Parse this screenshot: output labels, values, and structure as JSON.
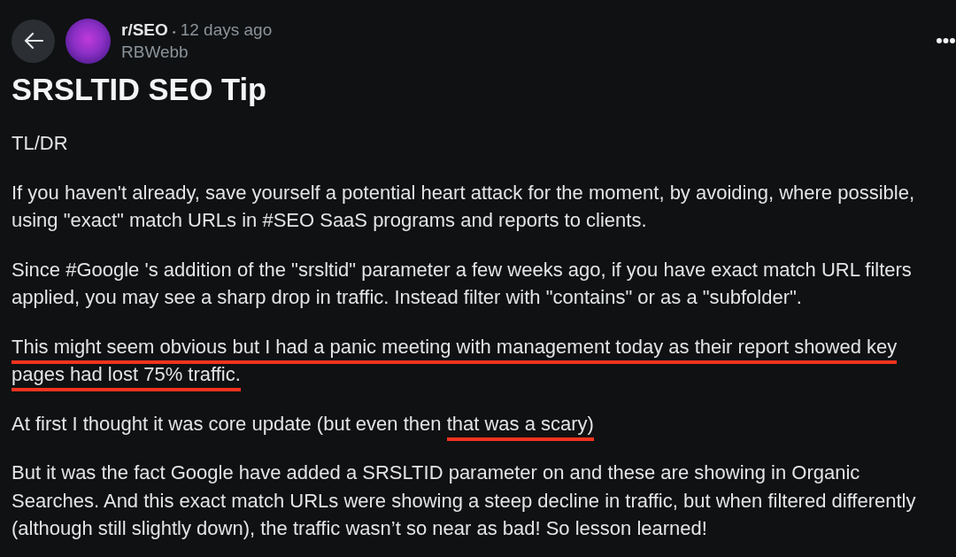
{
  "header": {
    "community": "r/SEO",
    "separator": "•",
    "time": "12 days ago",
    "author": "RBWebb"
  },
  "title": "SRSLTID SEO Tip",
  "body": [
    {
      "segments": [
        {
          "text": "TL/DR",
          "underlined": false
        }
      ]
    },
    {
      "segments": [
        {
          "text": "If you haven't already, save yourself a potential heart attack for the moment, by avoiding, where possible, using \"exact\" match URLs in #SEO SaaS programs and reports to clients.",
          "underlined": false
        }
      ]
    },
    {
      "segments": [
        {
          "text": "Since #Google 's addition of the \"srsltid\" parameter a few weeks ago, if you have exact match URL filters applied, you may see a sharp drop in traffic. Instead filter with \"contains\" or as a \"subfolder\".",
          "underlined": false
        }
      ]
    },
    {
      "segments": [
        {
          "text": "This might seem obvious but I had a panic meeting with management today as their report showed key pages had lost 75% traffic.",
          "underlined": true
        }
      ]
    },
    {
      "segments": [
        {
          "text": "At first I thought it was core update (but even then ",
          "underlined": false
        },
        {
          "text": "that was a scary)",
          "underlined": true
        }
      ]
    },
    {
      "segments": [
        {
          "text": "But it was the fact Google have added a SRSLTID parameter on and these are showing in Organic Searches. And this exact match URLs were showing a steep decline in traffic, but when filtered differently (although still slightly down), the traffic wasn’t so near as bad! So lesson learned!",
          "underlined": false
        }
      ]
    }
  ]
}
